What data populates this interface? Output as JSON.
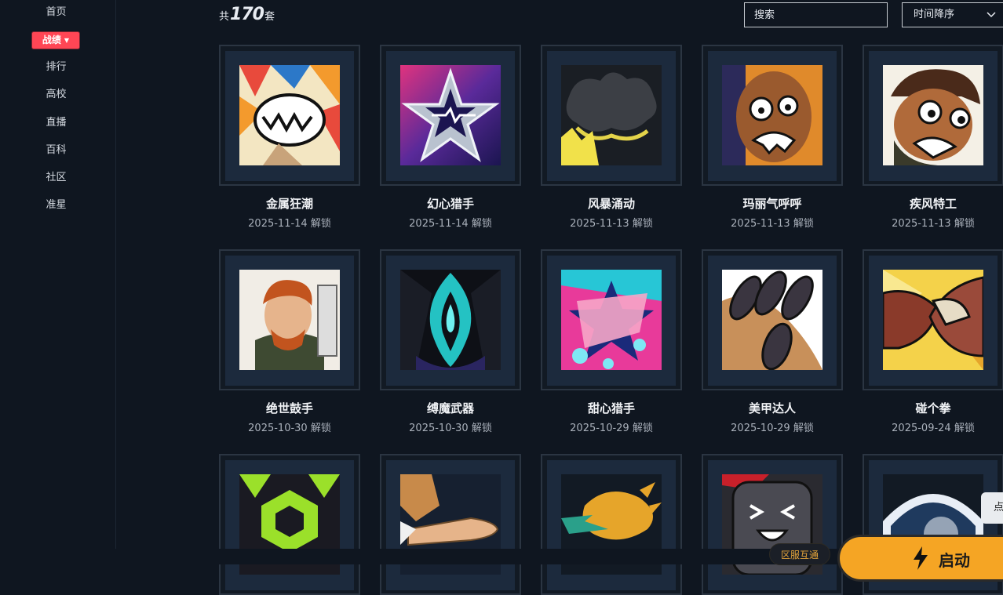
{
  "sidebar": {
    "items": [
      {
        "label": "首页"
      },
      {
        "label": "战绩"
      },
      {
        "label": "排行"
      },
      {
        "label": "高校"
      },
      {
        "label": "直播"
      },
      {
        "label": "百科"
      },
      {
        "label": "社区"
      },
      {
        "label": "准星"
      }
    ],
    "active_index": 1
  },
  "header": {
    "count_prefix": "共",
    "count_value": "170",
    "count_suffix": "套",
    "search_placeholder": "搜索",
    "sort_label": "时间降序"
  },
  "cards": [
    {
      "name": "金属狂潮",
      "date": "2025-11-14 解锁",
      "icon": "metal-frenzy-art"
    },
    {
      "name": "幻心猎手",
      "date": "2025-11-14 解锁",
      "icon": "phantom-heart-star-art"
    },
    {
      "name": "风暴涌动",
      "date": "2025-11-13 解锁",
      "icon": "storm-surge-art"
    },
    {
      "name": "玛丽气呼呼",
      "date": "2025-11-13 解锁",
      "icon": "angry-character-art"
    },
    {
      "name": "疾风特工",
      "date": "2025-11-13 解锁",
      "icon": "agent-face-art"
    },
    {
      "name": "绝世鼓手",
      "date": "2025-10-30 解锁",
      "icon": "drummer-art"
    },
    {
      "name": "缚魔武器",
      "date": "2025-10-30 解锁",
      "icon": "demon-weapon-art"
    },
    {
      "name": "甜心猎手",
      "date": "2025-10-29 解锁",
      "icon": "sweet-hunter-art"
    },
    {
      "name": "美甲达人",
      "date": "2025-10-29 解锁",
      "icon": "nail-art"
    },
    {
      "name": "碰个拳",
      "date": "2025-09-24 解锁",
      "icon": "fist-bump-art"
    },
    {
      "name": "",
      "date": "",
      "icon": "green-hex-art"
    },
    {
      "name": "",
      "date": "",
      "icon": "bullet-art"
    },
    {
      "name": "",
      "date": "",
      "icon": "yellow-splash-art"
    },
    {
      "name": "",
      "date": "",
      "icon": "ghost-art"
    },
    {
      "name": "",
      "date": "",
      "icon": "helmet-art"
    }
  ],
  "footer": {
    "server_label": "区服互通",
    "launch_label": "启动",
    "side_tab_label": "点"
  },
  "colors": {
    "background": "#0f1620",
    "accent": "#ff4655",
    "launch": "#f5a524"
  }
}
